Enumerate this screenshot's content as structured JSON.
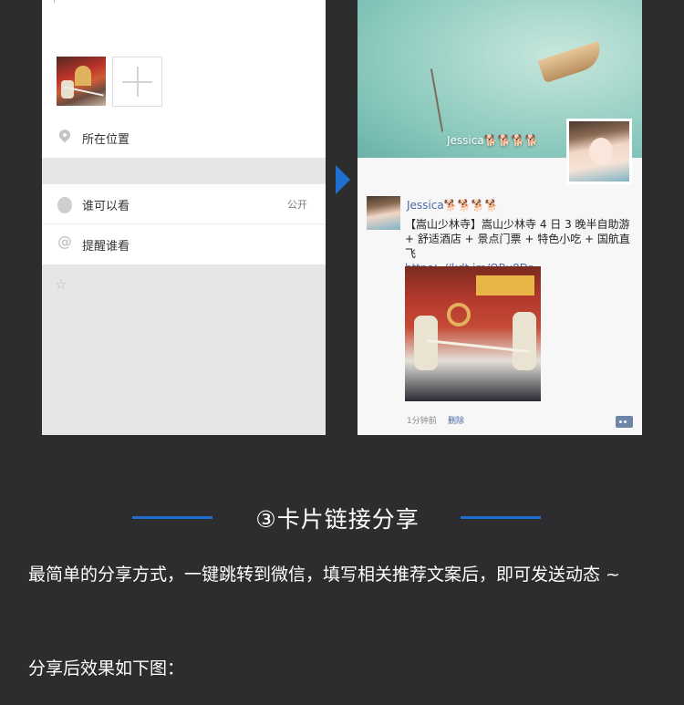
{
  "left_screen": {
    "location_label": "所在位置",
    "visibility_label": "谁可以看",
    "visibility_value": "公开",
    "remind_label": "提醒谁看",
    "icons": [
      "location-pin-icon",
      "globe-icon",
      "at-icon",
      "star-icon",
      "add-photo-icon"
    ]
  },
  "right_screen": {
    "cover_name": "Jessica🐕🐕🐕🐕",
    "post": {
      "name": "Jessica🐕🐕🐕🐕",
      "text": "【嵩山少林寺】嵩山少林寺 4 日 3 晚半自助游 + 舒适酒店 + 景点门票 + 特色小吃 + 国航直飞",
      "link": "https：//kdt.im/QRu8Dr",
      "time": "1分钟前",
      "delete_label": "删除"
    }
  },
  "section": {
    "heading": "③卡片链接分享",
    "paragraph1": "最简单的分享方式，一键跳转到微信，填写相关推荐文案后，即可发送动态 ~",
    "paragraph2": "分享后效果如下图："
  },
  "colors": {
    "background": "#2d2d2f",
    "accent": "#1f6fd1",
    "link": "#4a6aa5"
  }
}
